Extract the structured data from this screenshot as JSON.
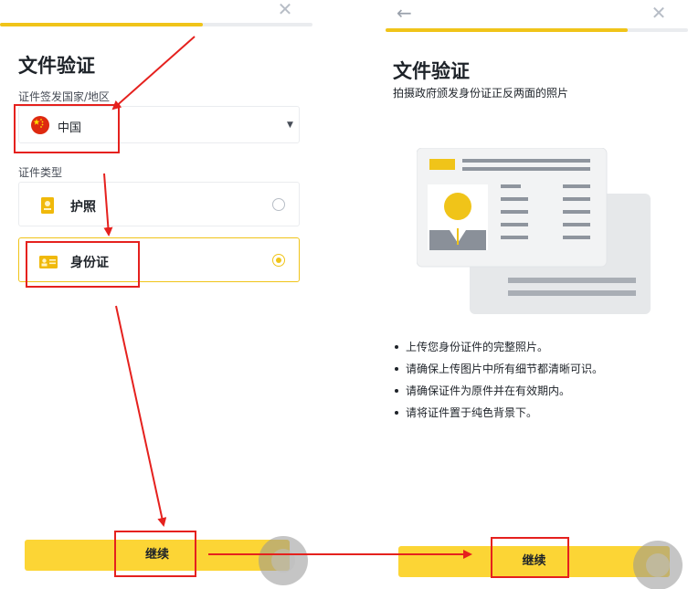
{
  "left": {
    "title": "文件验证",
    "country_label": "证件签发国家/地区",
    "country_value": "中国",
    "doc_type_label": "证件类型",
    "options": [
      {
        "label": "护照",
        "selected": false,
        "icon": "passport-icon"
      },
      {
        "label": "身份证",
        "selected": true,
        "icon": "id-card-icon"
      }
    ],
    "continue_label": "继续",
    "progress": 0.65
  },
  "right": {
    "title": "文件验证",
    "subtitle": "拍摄政府颁发身份证正反两面的照片",
    "bullets": [
      "上传您身份证件的完整照片。",
      "请确保上传图片中所有细节都清晰可识。",
      "请确保证件为原件并在有效期内。",
      "请将证件置于纯色背景下。"
    ],
    "continue_label": "继续",
    "progress": 0.8
  },
  "colors": {
    "accent": "#fcd535",
    "annotation": "#e5211e"
  }
}
